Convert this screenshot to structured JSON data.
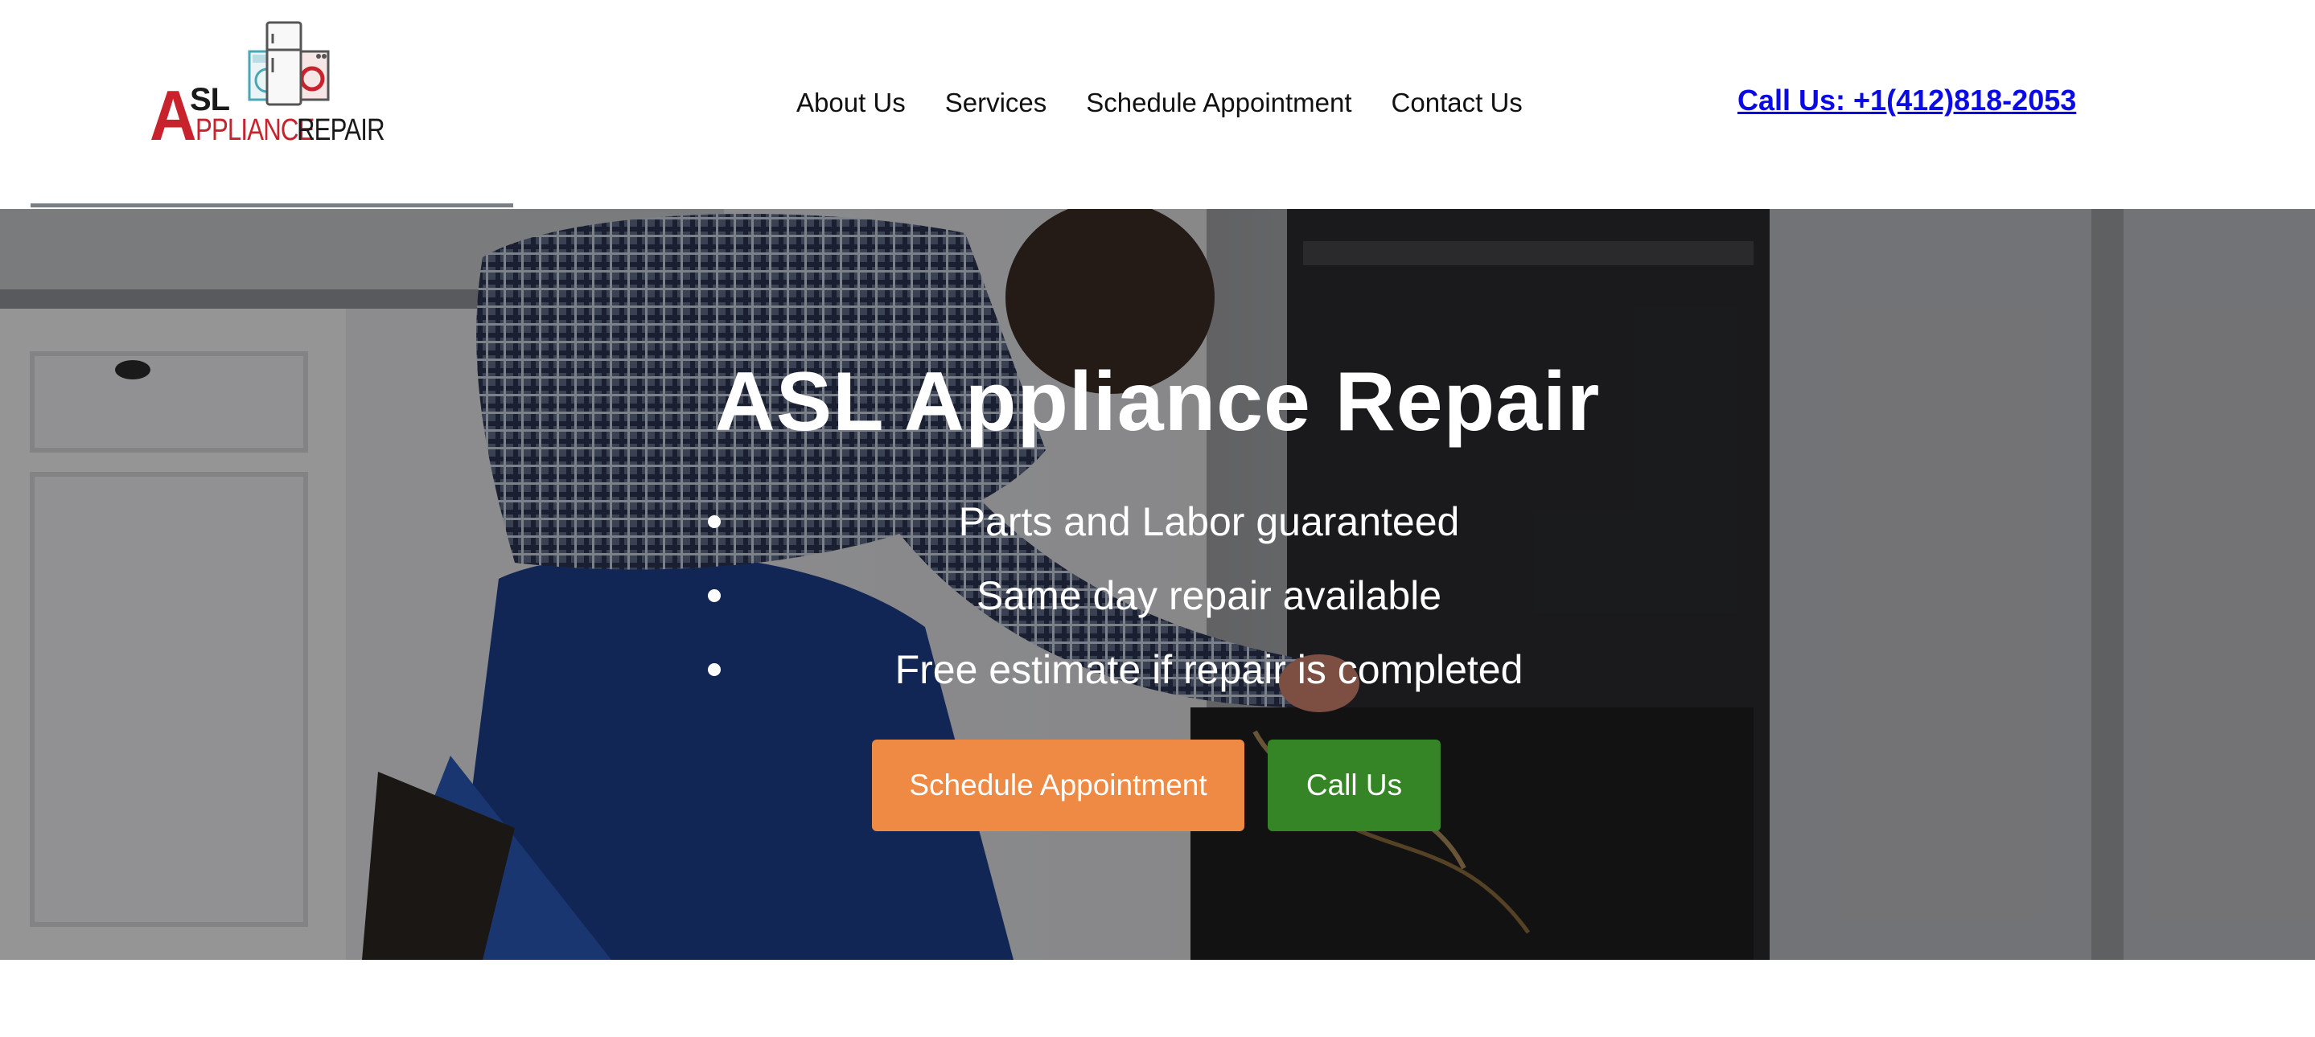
{
  "header": {
    "logo": {
      "alt": "ASL Appliance Repair logo",
      "letter_a": "A",
      "letters_sl": "SL",
      "word_appliance": "PPLIANCE",
      "word_repair": "REPAIR"
    },
    "nav": [
      {
        "label": "About Us"
      },
      {
        "label": "Services"
      },
      {
        "label": "Schedule Appointment"
      },
      {
        "label": "Contact Us"
      }
    ],
    "call_link": "Call Us: +1(412)818-2053"
  },
  "hero": {
    "title": "ASL Appliance Repair",
    "bullets": [
      "Parts and Labor guaranteed",
      "Same day repair available",
      "Free estimate if repair is completed"
    ],
    "buttons": {
      "schedule": "Schedule Appointment",
      "call": "Call Us"
    }
  },
  "colors": {
    "logo_red": "#c8232c",
    "link_blue": "#0a0ae6",
    "schedule_button": "#ef8a44",
    "call_button": "#358425"
  }
}
